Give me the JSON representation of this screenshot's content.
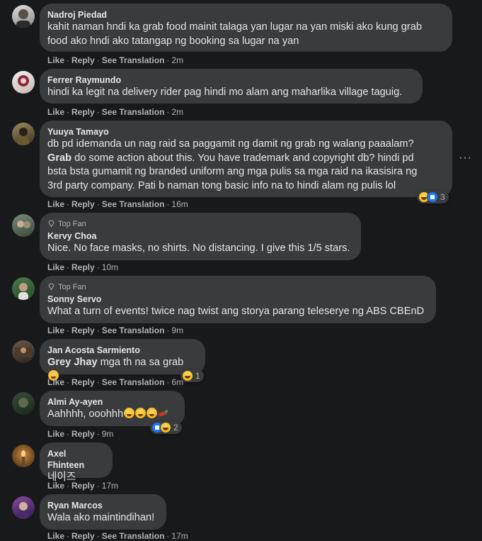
{
  "action_labels": {
    "like": "Like",
    "reply": "Reply",
    "see_translation": "See Translation",
    "dot": "·"
  },
  "top_fan_label": "Top Fan",
  "more_options": "···",
  "comments": [
    {
      "author": "Nadroj Piedad",
      "text": "kahit naman hndi ka grab food mainit talaga yan lugar na yan miski ako kung grab\nfood ako hndi ako tatangap ng booking sa lugar na yan",
      "time": "2m"
    },
    {
      "author": "Ferrer Raymundo",
      "text": "hindi ka legit na delivery rider pag hindi mo alam ang maharlika village taguig.",
      "time": "2m"
    },
    {
      "author": "Yuuya Tamayo",
      "text_line1": "db pd idemanda un nag raid sa paggamit ng damit ng grab ng walang paaalam?",
      "mention": "Grab",
      "text_rest": " do some action about this. You have trademark and copyright db? hindi pd\nbsta bsta gumamit ng branded uniform ang mga pulis sa mga raid na ikasisira ng\n3rd party company. Pati b naman tong basic info na to hindi alam ng pulis lol",
      "time": "16m",
      "reaction_count": "3"
    },
    {
      "author": "Kervy Choa",
      "text": "Nice. No face masks, no shirts. No distancing. I give this 1/5 stars.",
      "time": "10m"
    },
    {
      "author": "Sonny Servo",
      "text": "What a turn of events! twice nag twist ang storya parang teleserye ng ABS CBEnD",
      "time": "9m"
    },
    {
      "author": "Jan Acosta Sarmiento",
      "mention": "Grey Jhay",
      "text": " mga th na sa grab ",
      "time": "6m",
      "reaction_count": "1"
    },
    {
      "author": "Almi Ay-ayen",
      "text": "Aahhhh, ooohhh",
      "time": "9m",
      "reaction_count": "2"
    },
    {
      "author": "Axel Fhinteen",
      "text": "네이즈",
      "time": "17m"
    },
    {
      "author": "Ryan Marcos",
      "text": "Wala ako maintindihan!",
      "time": "17m"
    }
  ],
  "colors": {
    "background": "#18191a",
    "bubble": "#3a3b3c",
    "text": "#e4e6eb",
    "secondary": "#b0b3b8",
    "like_blue": "#1877f2",
    "haha_yellow": "#f4b400"
  }
}
